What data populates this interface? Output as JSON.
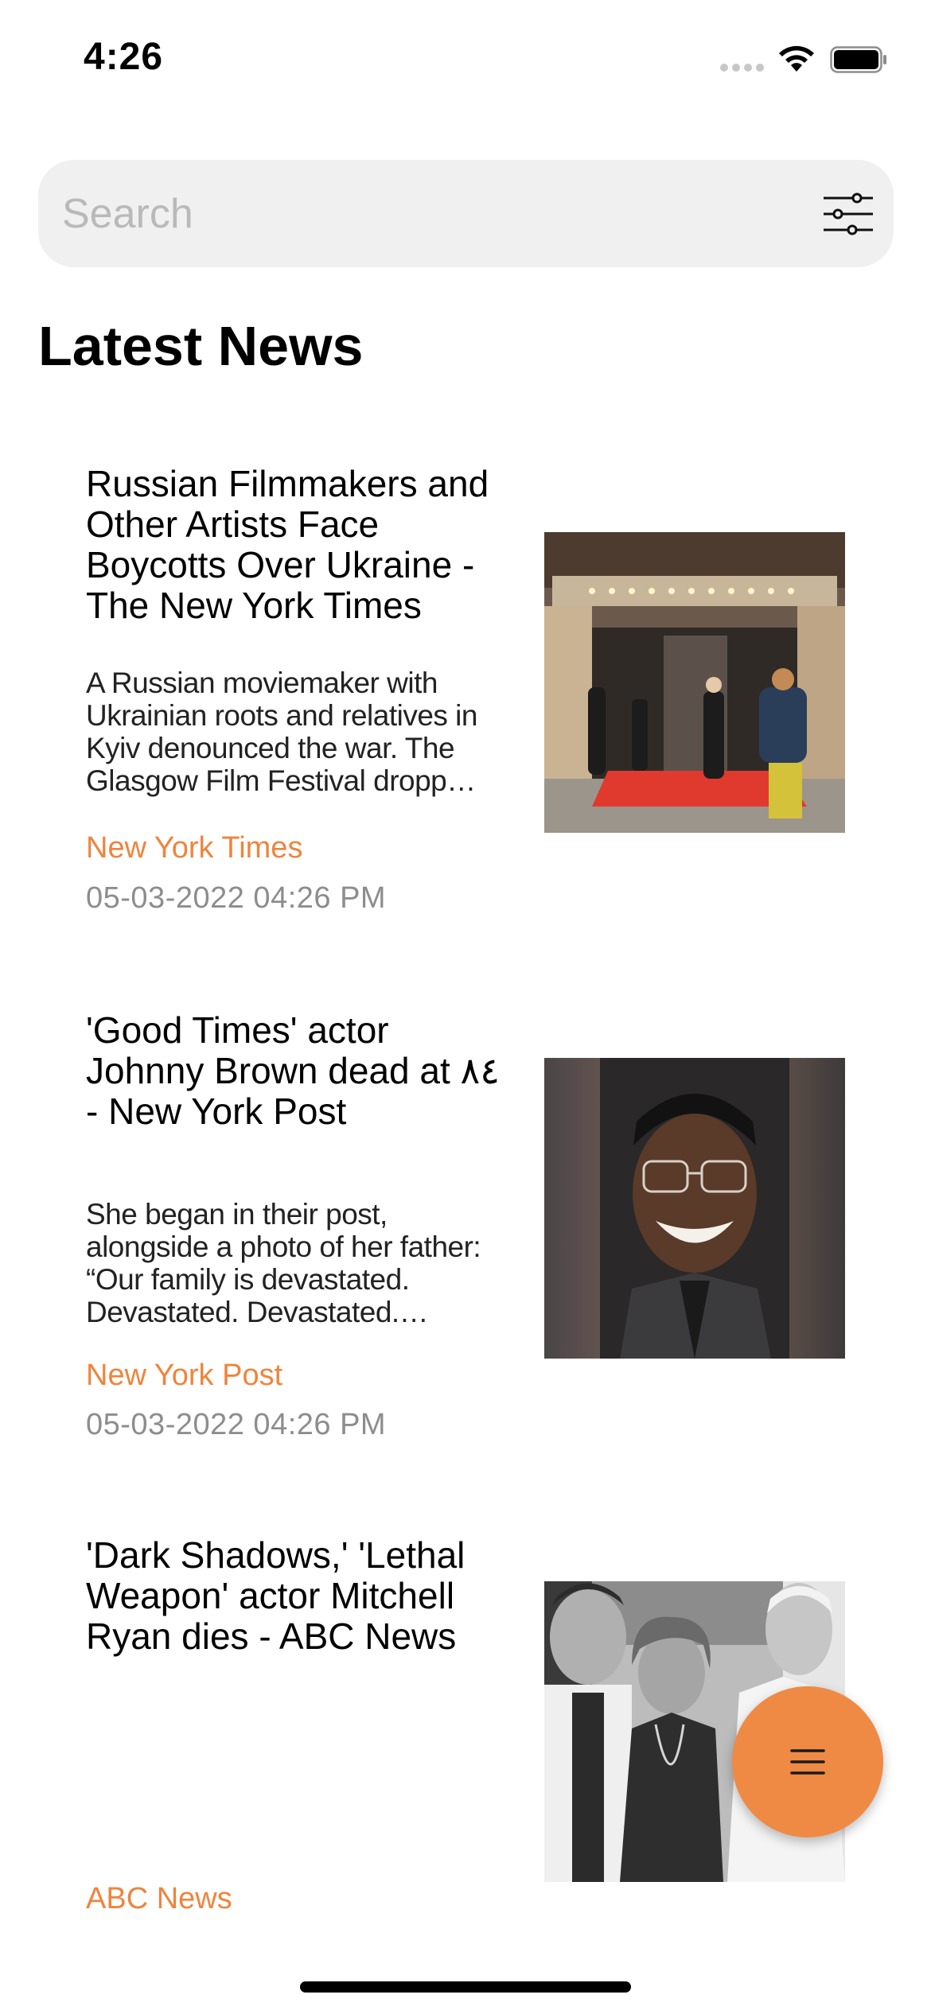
{
  "status_bar": {
    "time": "4:26"
  },
  "search": {
    "placeholder": "Search",
    "filter_icon": "sliders-icon"
  },
  "page": {
    "title": "Latest News"
  },
  "articles": [
    {
      "title": "Russian Filmmakers and Other Artists Face Boycotts Over Ukraine - The New York Times",
      "description": "A Russian moviemaker with Ukrainian roots and relatives in Kyiv denounced the war. The Glasgow Film Festival dropp…",
      "source": "New York Times",
      "date": "05-03-2022 04:26 PM",
      "image": "theater-entrance-photo"
    },
    {
      "title": "'Good Times' actor Johnny Brown dead at ٨٤ - New York Post",
      "description": "She began in their post, alongside a photo of her father: “Our family is devastated. Devastated. Devastated.…",
      "source": "New York Post",
      "date": "05-03-2022 04:26 PM",
      "image": "portrait-photo"
    },
    {
      "title": "'Dark Shadows,' 'Lethal Weapon' actor Mitchell Ryan dies - ABC News",
      "description": "",
      "source": "ABC News",
      "date": "",
      "image": "group-photo"
    }
  ],
  "fab": {
    "icon": "menu-icon"
  },
  "colors": {
    "accent": "#ef843d",
    "search_background": "#f0f0f0",
    "date_text": "#8d8d8d"
  }
}
